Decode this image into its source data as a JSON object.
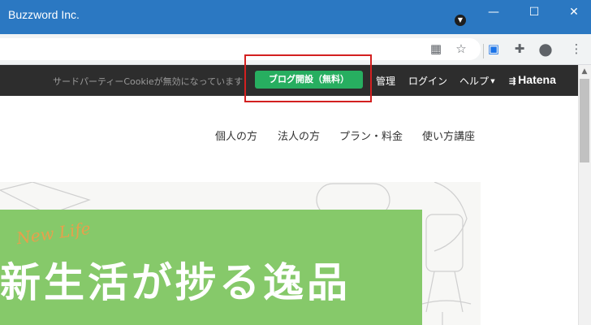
{
  "window": {
    "title": "Buzzword Inc.",
    "minimize": "—",
    "maximize": "☐",
    "close": "✕"
  },
  "toolbar": {
    "qr": "▦",
    "star": "☆",
    "ext1": "▣",
    "puzzle": "✚",
    "profile": "●",
    "menu": "⋮"
  },
  "hatena_bar": {
    "cookie_notice": "サードパーティーCookieが無効になっています",
    "open_blog": "ブログ開設（無料）",
    "manage": "管理",
    "login": "ログイン",
    "help": "ヘルプ",
    "logo": "Hatena"
  },
  "nav": {
    "personal": "個人の方",
    "corporate": "法人の方",
    "plans": "プラン・料金",
    "howto": "使い方講座"
  },
  "hero": {
    "script": "New Life",
    "title": "新生活が捗る逸品"
  },
  "colors": {
    "titlebar": "#2b78c2",
    "hatena_bar": "#2d2d2d",
    "cta": "#27ae60",
    "highlight": "#d32020",
    "hero_green": "#86c96a"
  }
}
